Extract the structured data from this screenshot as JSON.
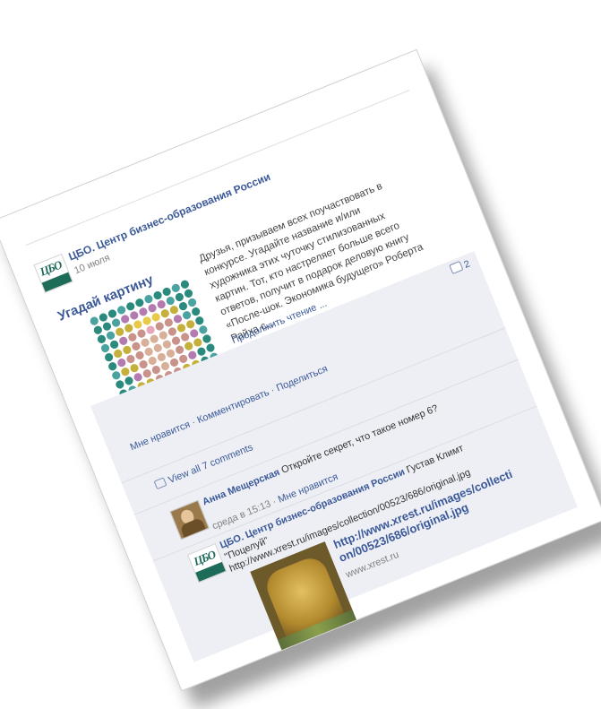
{
  "post": {
    "author": "ЦБО. Центр бизнес-образования России",
    "date": "10 июля",
    "attachment_title": "Угадай картину",
    "description": "Друзья, призываем всех поучаствовать в конкурсе. Угадайте название и/или художника этих чуточку стилизованных картин. Тот, кто настреляет больше всего ответов, получит в подарок деловую книгу «После-шок. Экономика будущего» Роберта Райха с...",
    "read_more": "Продолжить чтение ...",
    "comment_count": "2"
  },
  "actions": {
    "like": "Мне нравится",
    "comment": "Комментировать",
    "share": "Поделиться"
  },
  "view_all": "View all 7 comments",
  "comments": [
    {
      "author": "Анна Мещерская",
      "text": "Откройте секрет, что такое номер 6?",
      "time": "среда в 15:13",
      "like": "Мне нравится"
    },
    {
      "author": "ЦБО. Центр бизнес-образования России",
      "text": "Густав Климт \"Поцелуй\" http://www.xrest.ru/images/collection/00523/686/original.jpg",
      "link_title": "http://www.xrest.ru/images/collection/00523/686/original.jpg",
      "link_domain": "www.xrest.ru"
    }
  ],
  "logo": {
    "mark": "ЦБО"
  },
  "colors": {
    "link": "#3b5998",
    "feedback_bg": "#edeff4",
    "logo_green": "#1d6b59"
  }
}
